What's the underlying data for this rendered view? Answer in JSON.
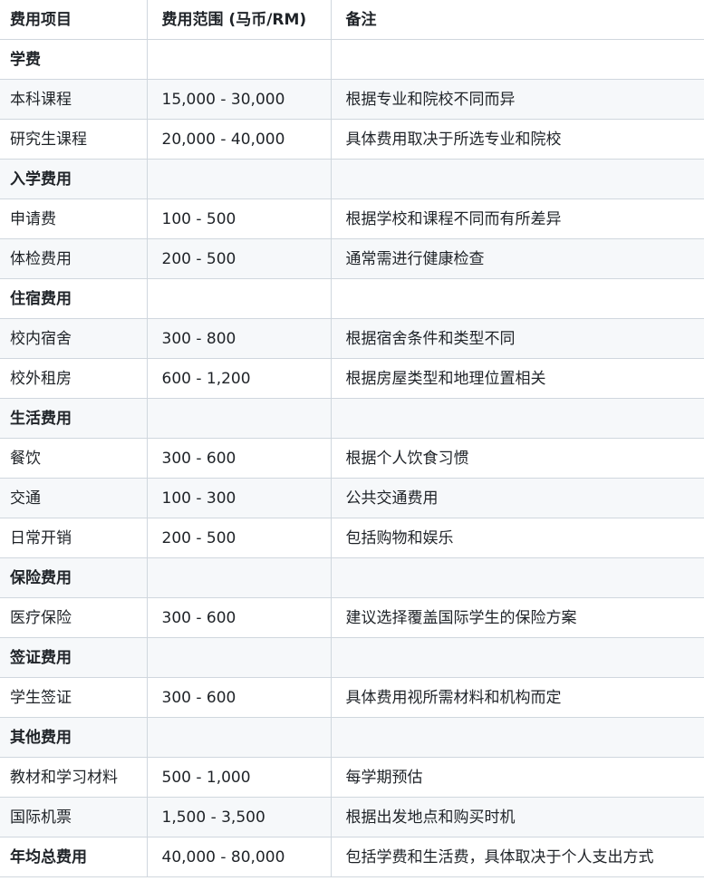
{
  "table": {
    "headers": [
      "费用项目",
      "费用范围 (马币/RM)",
      "备注"
    ],
    "rows": [
      {
        "item": "学费",
        "range": "",
        "note": "",
        "bold": true
      },
      {
        "item": "本科课程",
        "range": "15,000 - 30,000",
        "note": "根据专业和院校不同而异",
        "bold": false
      },
      {
        "item": "研究生课程",
        "range": "20,000 - 40,000",
        "note": "具体费用取决于所选专业和院校",
        "bold": false
      },
      {
        "item": "入学费用",
        "range": "",
        "note": "",
        "bold": true
      },
      {
        "item": "申请费",
        "range": "100 - 500",
        "note": "根据学校和课程不同而有所差异",
        "bold": false
      },
      {
        "item": "体检费用",
        "range": "200 - 500",
        "note": "通常需进行健康检查",
        "bold": false
      },
      {
        "item": "住宿费用",
        "range": "",
        "note": "",
        "bold": true
      },
      {
        "item": "校内宿舍",
        "range": "300 - 800",
        "note": "根据宿舍条件和类型不同",
        "bold": false
      },
      {
        "item": "校外租房",
        "range": "600 - 1,200",
        "note": "根据房屋类型和地理位置相关",
        "bold": false
      },
      {
        "item": "生活费用",
        "range": "",
        "note": "",
        "bold": true
      },
      {
        "item": "餐饮",
        "range": "300 - 600",
        "note": "根据个人饮食习惯",
        "bold": false
      },
      {
        "item": "交通",
        "range": "100 - 300",
        "note": "公共交通费用",
        "bold": false
      },
      {
        "item": "日常开销",
        "range": "200 - 500",
        "note": "包括购物和娱乐",
        "bold": false
      },
      {
        "item": "保险费用",
        "range": "",
        "note": "",
        "bold": true
      },
      {
        "item": "医疗保险",
        "range": "300 - 600",
        "note": "建议选择覆盖国际学生的保险方案",
        "bold": false
      },
      {
        "item": "签证费用",
        "range": "",
        "note": "",
        "bold": true
      },
      {
        "item": "学生签证",
        "range": "300 - 600",
        "note": "具体费用视所需材料和机构而定",
        "bold": false
      },
      {
        "item": "其他费用",
        "range": "",
        "note": "",
        "bold": true
      },
      {
        "item": "教材和学习材料",
        "range": "500 - 1,000",
        "note": "每学期预估",
        "bold": false
      },
      {
        "item": "国际机票",
        "range": "1,500 - 3,500",
        "note": "根据出发地点和购买时机",
        "bold": false
      },
      {
        "item": "年均总费用",
        "range": "40,000 - 80,000",
        "note": "包括学费和生活费，具体取决于个人支出方式",
        "bold": true
      }
    ]
  }
}
